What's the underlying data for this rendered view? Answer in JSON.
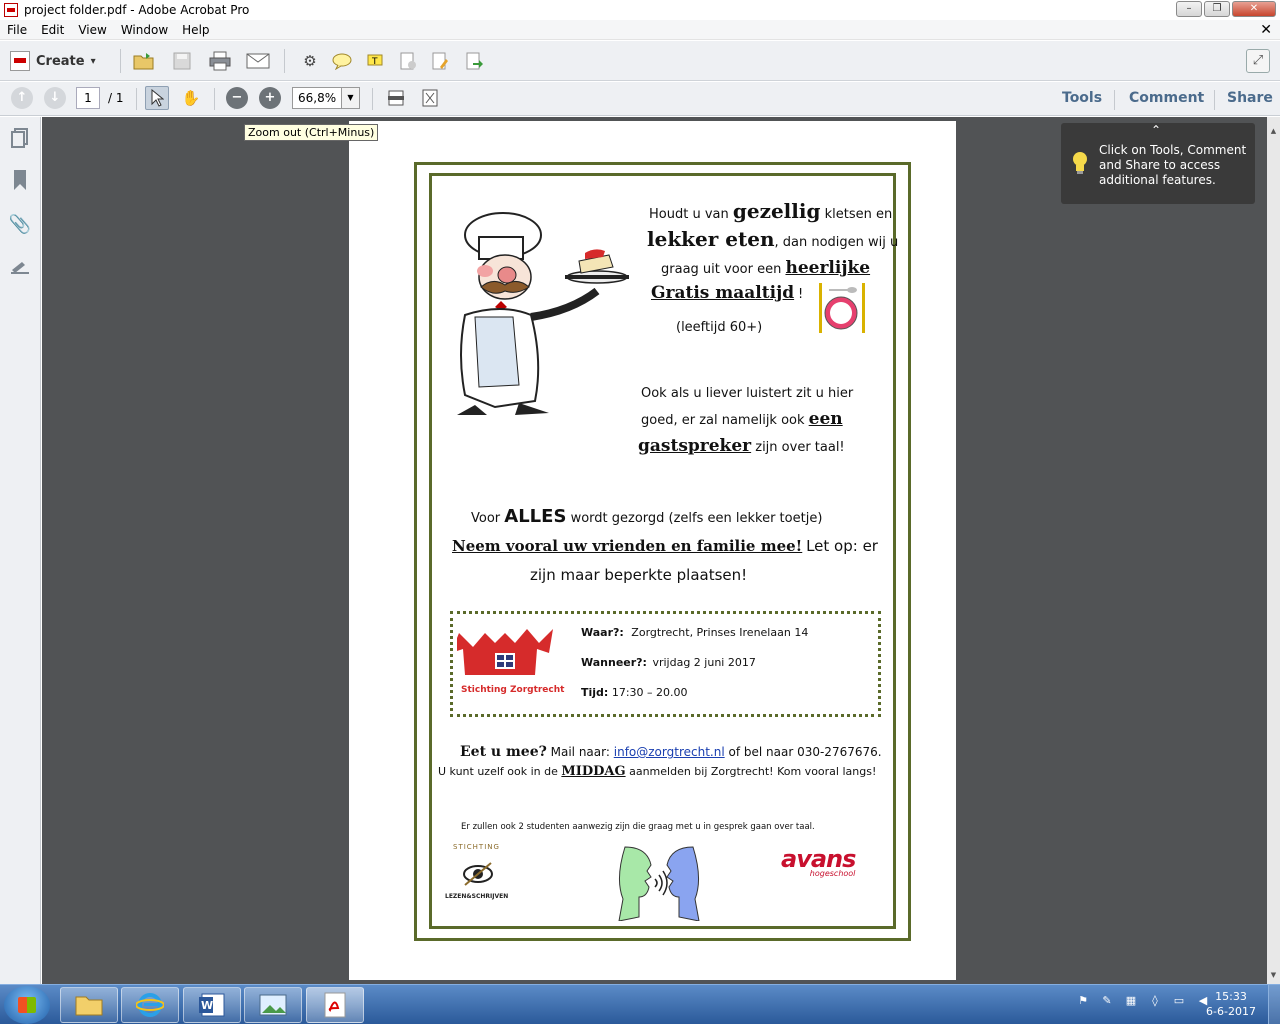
{
  "window": {
    "title": "project folder.pdf - Adobe Acrobat Pro",
    "min": "–",
    "max": "❐",
    "close": "✕"
  },
  "menu": [
    "File",
    "Edit",
    "View",
    "Window",
    "Help"
  ],
  "menu_doc_close": "✕",
  "toolbar": {
    "create_label": "Create",
    "create_caret": "▾"
  },
  "nav": {
    "page_current": "1",
    "page_total": "/ 1",
    "zoom": "66,8%",
    "zoom_caret": "▼"
  },
  "panels": {
    "tools": "Tools",
    "comment": "Comment",
    "share": "Share"
  },
  "tooltip": "Zoom out (Ctrl+Minus)",
  "callout": {
    "message": "Click on Tools, Comment and Share to access additional features.",
    "chevron": "⌃"
  },
  "flyer": {
    "intro_1a": "Houdt u van",
    "intro_1b": "gezellig",
    "intro_1c": "kletsen en",
    "intro_2a": "lekker eten",
    "intro_2b": ", dan nodigen wij u",
    "intro_3a": "graag uit voor een",
    "intro_3b": "heerlijke",
    "intro_4a": "Gratis maaltijd",
    "intro_4b": "!",
    "age": "(leeftijd 60+)",
    "speaker_1": "Ook als u liever luistert zit u hier",
    "speaker_2a": "goed, er zal namelijk ook",
    "speaker_2b": "een",
    "speaker_3a": "gastspreker",
    "speaker_3b": "zijn over taal!",
    "alles_a": "Voor",
    "alles_b": "ALLES",
    "alles_c": "wordt gezorgd (zelfs een lekker toetje)",
    "friends_a": "Neem vooral uw vrienden en familie mee!",
    "friends_b": "Let op: er",
    "friends_c": "zijn maar beperkte plaatsen!",
    "logo_text": "Stichting Zorgtrecht",
    "waar_label": "Waar?:",
    "waar_value": "Zorgtrecht, Prinses Irenelaan 14",
    "wanneer_label": "Wanneer?:",
    "wanneer_value": "vrijdag 2 juni 2017",
    "tijd_label": "Tijd:",
    "tijd_value": "17:30 – 20.00",
    "eet_a": "Eet u mee?",
    "eet_b": "Mail naar:",
    "eet_email": "info@zorgtrecht.nl",
    "eet_c": "of bel naar 030-2767676.",
    "middag_a": "U kunt uzelf ook in de",
    "middag_b": "MIDDAG",
    "middag_c": "aanmelden bij Zorgtrecht! Kom vooral langs!",
    "students": "Er zullen ook 2 studenten aanwezig zijn die graag met u in gesprek gaan over taal.",
    "sls_top": "STICHTING",
    "sls_bottom": "LEZEN&SCHRIJVEN",
    "avans": "avans",
    "avans_sub": "hogeschool"
  },
  "clock": {
    "time": "15:33",
    "date": "6-6-2017"
  },
  "colors": {
    "frame": "#5a6a2a",
    "logo_red": "#d62b2b",
    "link_blue": "#1a3fb0",
    "avans_red": "#c8102e",
    "panel_link": "#4b6b8c"
  }
}
